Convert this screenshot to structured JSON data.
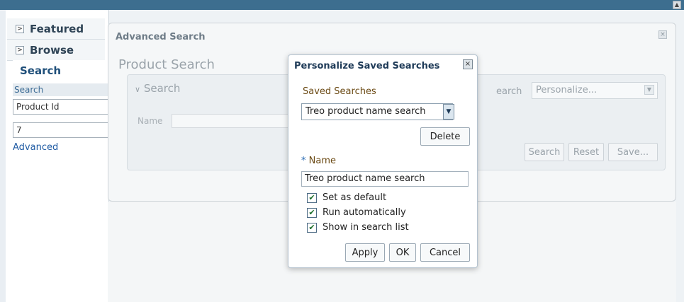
{
  "left_panel": {
    "featured_label": "Featured",
    "browse_label": "Browse",
    "search_label": "Search",
    "sub_label": "Search",
    "search_field_value": "Product Id",
    "search_value": "7",
    "advanced_link": "Advanced"
  },
  "advanced_dialog": {
    "title": "Advanced Search",
    "section_title": "Product Search",
    "inner_search_label": "Search",
    "name_label": "Name",
    "search_partial_label": "earch",
    "personalize_value": "Personalize...",
    "buttons": [
      "Search",
      "Reset",
      "Save..."
    ]
  },
  "personalize_dialog": {
    "title": "Personalize Saved Searches",
    "saved_searches_label": "Saved Searches",
    "saved_select_value": "Treo product name search",
    "delete_label": "Delete",
    "required_mark": "*",
    "name_label": "Name",
    "name_value": "Treo product name search",
    "checkboxes": [
      {
        "label": "Set as default",
        "checked": true
      },
      {
        "label": "Run automatically",
        "checked": true
      },
      {
        "label": "Show in search list",
        "checked": true
      }
    ],
    "apply_label": "Apply",
    "ok_label": "OK",
    "cancel_label": "Cancel"
  },
  "icons": {
    "collapsed": "chevron-right-icon",
    "close": "close-icon",
    "dropdown": "chevron-down-icon",
    "check": "checkmark-icon"
  }
}
